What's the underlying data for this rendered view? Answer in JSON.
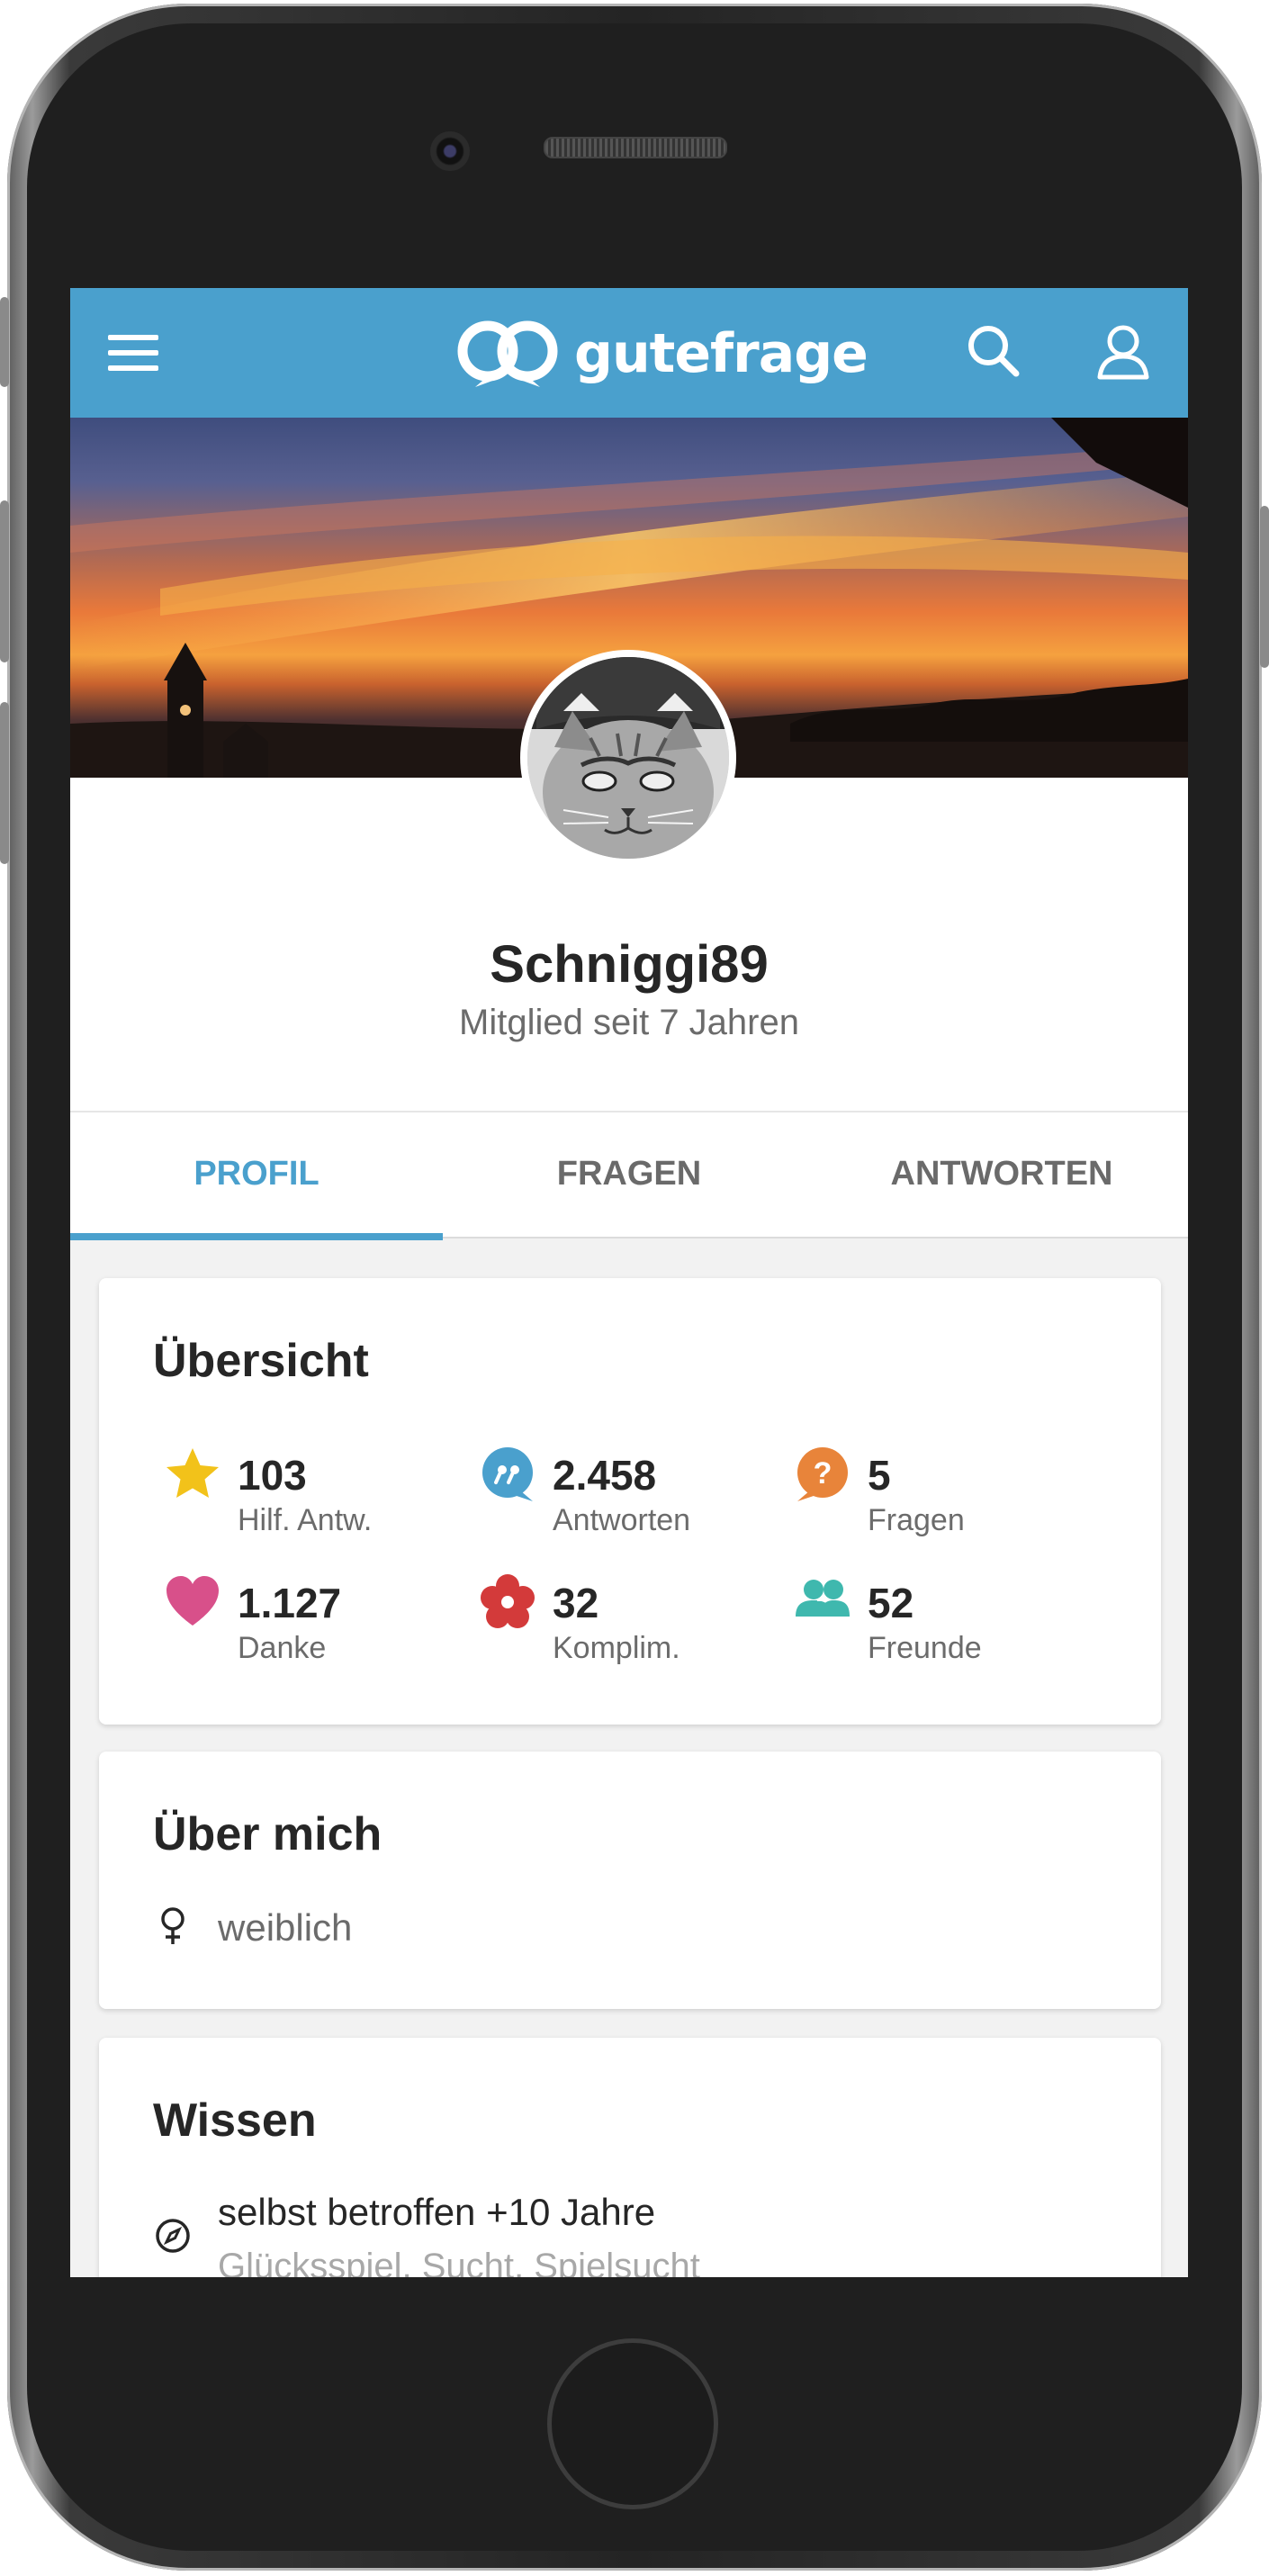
{
  "app": {
    "brand": "gutefrage"
  },
  "profile": {
    "username": "Schniggi89",
    "member_since": "Mitglied seit 7 Jahren"
  },
  "tabs": [
    {
      "label": "PROFIL",
      "active": true
    },
    {
      "label": "FRAGEN",
      "active": false
    },
    {
      "label": "ANTWORTEN",
      "active": false
    }
  ],
  "overview": {
    "title": "Übersicht",
    "stats": [
      {
        "icon": "star-icon",
        "value": "103",
        "label": "Hilf. Antw.",
        "color": "#f2c21a"
      },
      {
        "icon": "quote-bubble-icon",
        "value": "2.458",
        "label": "Antworten",
        "color": "#4aa0cd"
      },
      {
        "icon": "question-bubble-icon",
        "value": "5",
        "label": "Fragen",
        "color": "#e8843a"
      },
      {
        "icon": "heart-icon",
        "value": "1.127",
        "label": "Danke",
        "color": "#d8508a"
      },
      {
        "icon": "flower-icon",
        "value": "32",
        "label": "Komplim.",
        "color": "#d33a3a"
      },
      {
        "icon": "friends-icon",
        "value": "52",
        "label": "Freunde",
        "color": "#3fb8ae"
      }
    ]
  },
  "about": {
    "title": "Über mich",
    "gender": "weiblich"
  },
  "knowledge": {
    "title": "Wissen",
    "item_title": "selbst betroffen +10 Jahre",
    "item_tags": "Glücksspiel, Sucht, Spielsucht"
  },
  "colors": {
    "brand": "#4aa0cd",
    "text": "#262626",
    "muted": "#6b6b6b"
  }
}
